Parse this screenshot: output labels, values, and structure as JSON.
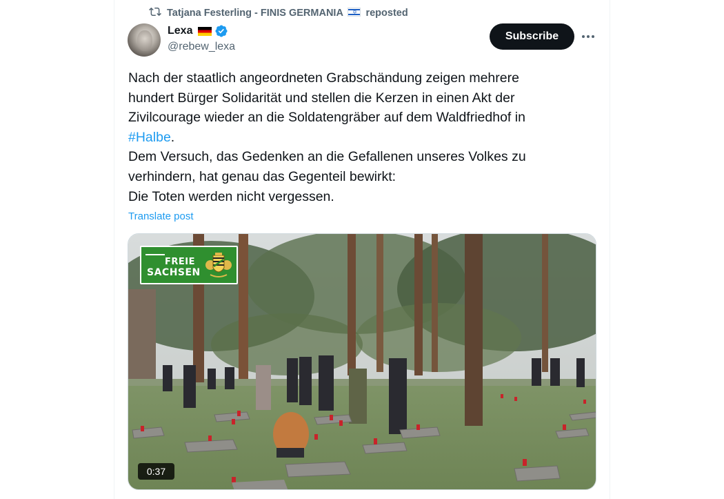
{
  "repost": {
    "reposter_name": "Tatjana Festerling - FINIS GERMANIA",
    "suffix": "reposted"
  },
  "author": {
    "name": "Lexa",
    "handle": "@rebew_lexa",
    "verified": true
  },
  "actions": {
    "subscribe_label": "Subscribe"
  },
  "post": {
    "lines": [
      "Nach der staatlich angeordneten Grabschändung zeigen mehrere",
      "hundert Bürger Solidarität und stellen die Kerzen in einen Akt der",
      "Zivilcourage wieder an die Soldatengräber auf dem Waldfriedhof in"
    ],
    "hashtag": "#Halbe",
    "hashtag_suffix": ".",
    "lines_after": [
      "Dem Versuch, das Gedenken an die Gefallenen unseres Volkes zu",
      "verhindern, hat genau das Gegenteil bewirkt:",
      "Die Toten werden nicht vergessen."
    ],
    "translate_label": "Translate post"
  },
  "media": {
    "logo_line1": "FREIE",
    "logo_line2": "SACHSEN",
    "duration": "0:37"
  },
  "colors": {
    "accent": "#1d9bf0",
    "secondary_text": "#536471",
    "primary_text": "#0f1419",
    "logo_green": "#2f8f2f"
  }
}
